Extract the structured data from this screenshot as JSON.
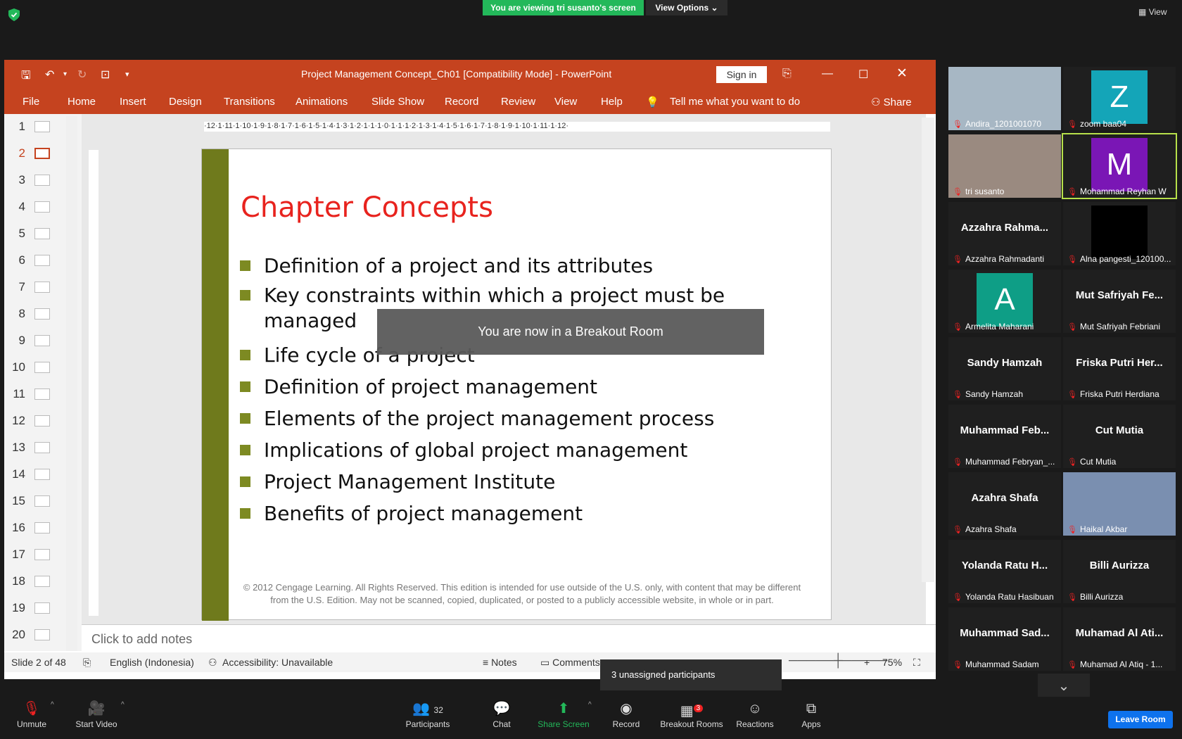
{
  "zoom": {
    "viewing_banner": "You are viewing tri susanto's screen",
    "view_options": "View Options",
    "view_button": "View",
    "breakout_toast": "You are now in a Breakout Room",
    "unassigned": "3 unassigned participants",
    "leave_room": "Leave Room",
    "toolbar": {
      "unmute": "Unmute",
      "start_video": "Start Video",
      "participants": "Participants",
      "participants_count": "32",
      "chat": "Chat",
      "share_screen": "Share Screen",
      "record": "Record",
      "breakout_rooms": "Breakout Rooms",
      "breakout_badge": "3",
      "reactions": "Reactions",
      "apps": "Apps"
    },
    "tiles": [
      {
        "name": "Andira_1201001070",
        "type": "photo",
        "color": "#a7b7c4"
      },
      {
        "name": "zoom baa04",
        "type": "avatar",
        "letter": "Z",
        "color": "#14a5b8"
      },
      {
        "name": "tri susanto",
        "type": "photo",
        "color": "#9a8a80"
      },
      {
        "name": "Mohammad Reyhan W",
        "type": "avatar",
        "letter": "M",
        "color": "#7a16b5"
      },
      {
        "name": "Azzahra Rahmadanti",
        "type": "text",
        "big": "Azzahra Rahma..."
      },
      {
        "name": "Alna pangesti_120100...",
        "type": "avatar",
        "letter": "",
        "color": "#000000"
      },
      {
        "name": "Armelita Maharani",
        "type": "avatar",
        "letter": "A",
        "color": "#0e9e86"
      },
      {
        "name": "Mut Safriyah Febriani",
        "type": "text",
        "big": "Mut Safriyah Fe..."
      },
      {
        "name": "Sandy Hamzah",
        "type": "text",
        "big": "Sandy Hamzah"
      },
      {
        "name": "Friska Putri Herdiana",
        "type": "text",
        "big": "Friska Putri Her..."
      },
      {
        "name": "Muhammad Febryan_...",
        "type": "text",
        "big": "Muhammad Feb..."
      },
      {
        "name": "Cut Mutia",
        "type": "text",
        "big": "Cut Mutia"
      },
      {
        "name": "Azahra Shafa",
        "type": "text",
        "big": "Azahra Shafa"
      },
      {
        "name": "Haikal Akbar",
        "type": "photo",
        "color": "#7a8fb0"
      },
      {
        "name": "Yolanda Ratu Hasibuan",
        "type": "text",
        "big": "Yolanda Ratu H..."
      },
      {
        "name": "Billi Aurizza",
        "type": "text",
        "big": "Billi Aurizza"
      },
      {
        "name": "Muhammad Sadam",
        "type": "text",
        "big": "Muhammad Sad..."
      },
      {
        "name": "Muhamad Al Atiq - 1...",
        "type": "text",
        "big": "Muhamad Al Ati..."
      }
    ]
  },
  "ppt": {
    "title": "Project Management Concept_Ch01 [Compatibility Mode]  -  PowerPoint",
    "sign_in": "Sign in",
    "menu": [
      "File",
      "Home",
      "Insert",
      "Design",
      "Transitions",
      "Animations",
      "Slide Show",
      "Record",
      "Review",
      "View",
      "Help"
    ],
    "tell_me": "Tell me what you want to do",
    "share": "Share",
    "ruler_h": "·12·1·11·1·10·1·9·1·8·1·7·1·6·1·5·1·4·1·3·1·2·1·1·1·0·1·1·1·2·1·3·1·4·1·5·1·6·1·7·1·8·1·9·1·10·1·11·1·12·",
    "thumbnails": [
      "1",
      "2",
      "3",
      "4",
      "5",
      "6",
      "7",
      "8",
      "9",
      "10",
      "11",
      "12",
      "13",
      "14",
      "15",
      "16",
      "17",
      "18",
      "19",
      "20"
    ],
    "slide": {
      "title": "Chapter Concepts",
      "bullets": [
        "Definition of a project and its attributes",
        "Key constraints within which a project must be managed",
        "Life cycle of a project",
        "Definition of project management",
        "Elements of the project management process",
        "Implications of global project management",
        "Project Management Institute",
        "Benefits of project management"
      ],
      "footer": "© 2012 Cengage Learning. All Rights Reserved. This edition is intended for use outside of the U.S. only, with content that may be different from the U.S. Edition. May not be scanned, copied, duplicated, or posted to a publicly accessible website, in whole or in part."
    },
    "notes_placeholder": "Click to add notes",
    "status": {
      "slide": "Slide 2 of 48",
      "language": "English (Indonesia)",
      "accessibility": "Accessibility: Unavailable",
      "notes": "Notes",
      "comments": "Comments",
      "zoom": "75%"
    }
  }
}
